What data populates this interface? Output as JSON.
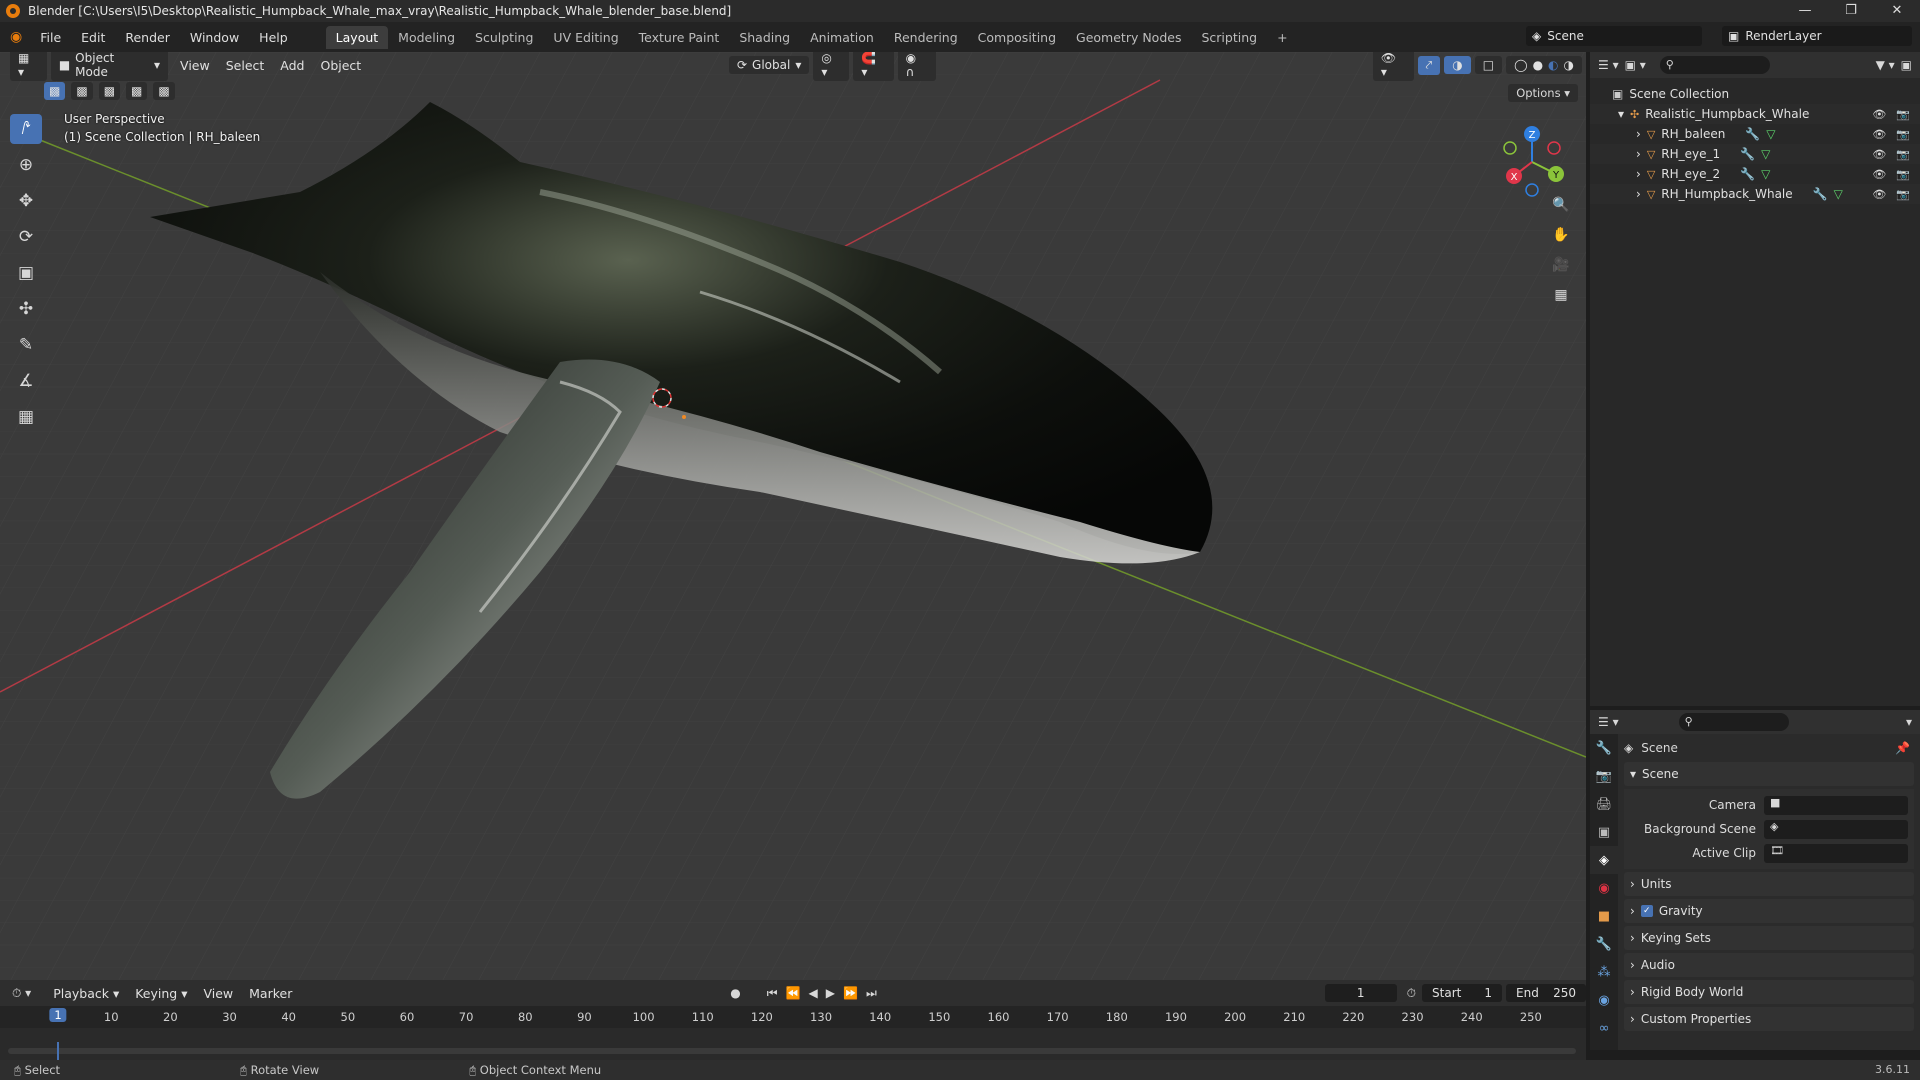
{
  "window": {
    "title": "Blender [C:\\Users\\I5\\Desktop\\Realistic_Humpback_Whale_max_vray\\Realistic_Humpback_Whale_blender_base.blend]"
  },
  "menu": [
    "File",
    "Edit",
    "Render",
    "Window",
    "Help"
  ],
  "workspaces": [
    "Layout",
    "Modeling",
    "Sculpting",
    "UV Editing",
    "Texture Paint",
    "Shading",
    "Animation",
    "Rendering",
    "Compositing",
    "Geometry Nodes",
    "Scripting"
  ],
  "active_workspace": "Layout",
  "scene_name": "Scene",
  "render_layer": "RenderLayer",
  "viewport": {
    "mode": "Object Mode",
    "menus": [
      "View",
      "Select",
      "Add",
      "Object"
    ],
    "orientation": "Global",
    "options": "Options",
    "perspective": "User Perspective",
    "collection_info": "(1) Scene Collection | RH_baleen",
    "gizmo": {
      "x": "X",
      "y": "Y",
      "z": "Z",
      "x_color": "#e0364a",
      "y_color": "#8bc43a",
      "z_color": "#2f7fe0"
    }
  },
  "outliner": {
    "root": "Scene Collection",
    "collection": "Realistic_Humpback_Whale",
    "objects": [
      "RH_baleen",
      "RH_eye_1",
      "RH_eye_2",
      "RH_Humpback_Whale"
    ]
  },
  "properties": {
    "context": "Scene",
    "panel_scene": "Scene",
    "fields": [
      {
        "label": "Camera"
      },
      {
        "label": "Background Scene"
      },
      {
        "label": "Active Clip"
      }
    ],
    "subpanels": [
      "Units",
      "Gravity",
      "Keying Sets",
      "Audio",
      "Rigid Body World",
      "Custom Properties"
    ],
    "gravity_checked": true
  },
  "timeline": {
    "menus": [
      "Playback",
      "Keying",
      "View",
      "Marker"
    ],
    "current_frame": "1",
    "start_label": "Start",
    "start": "1",
    "end_label": "End",
    "end": "250",
    "ticks": [
      "1",
      "10",
      "20",
      "30",
      "40",
      "50",
      "60",
      "70",
      "80",
      "90",
      "100",
      "110",
      "120",
      "130",
      "140",
      "150",
      "160",
      "170",
      "180",
      "190",
      "200",
      "210",
      "220",
      "230",
      "240",
      "250"
    ]
  },
  "status": {
    "left": "Select",
    "middle": "Rotate View",
    "right": "Object Context Menu",
    "version": "3.6.11"
  },
  "colors": {
    "accent": "#4772b3",
    "object_orange": "#e39a4a"
  }
}
